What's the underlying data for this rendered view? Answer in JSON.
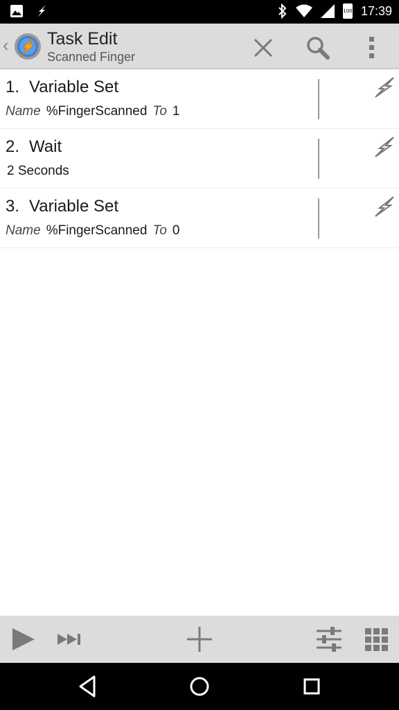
{
  "status_bar": {
    "time": "17:39",
    "battery": "100",
    "left_icons": [
      "image-icon",
      "tasker-bolt-icon"
    ],
    "right_icons": [
      "bluetooth-icon",
      "wifi-icon",
      "signal-icon",
      "battery-icon"
    ]
  },
  "action_bar": {
    "title": "Task Edit",
    "subtitle": "Scanned Finger",
    "actions": [
      "close-icon",
      "search-icon",
      "overflow-menu-icon"
    ]
  },
  "actions": [
    {
      "number": "1.",
      "name": "Variable Set",
      "params": [
        {
          "key": "Name",
          "value": "%FingerScanned"
        },
        {
          "key": "To",
          "value": "1"
        }
      ]
    },
    {
      "number": "2.",
      "name": "Wait",
      "text": "2 Seconds"
    },
    {
      "number": "3.",
      "name": "Variable Set",
      "params": [
        {
          "key": "Name",
          "value": "%FingerScanned"
        },
        {
          "key": "To",
          "value": "0"
        }
      ]
    }
  ],
  "toolbar": [
    "play-icon",
    "step-icon",
    "add-icon",
    "settings-sliders-icon",
    "grid-icon"
  ],
  "nav_bar": [
    "back-icon",
    "home-icon",
    "recents-icon"
  ],
  "colors": {
    "bar": "#dcdcdc",
    "icon": "#7a7a7a",
    "text": "#1a1a1a"
  }
}
